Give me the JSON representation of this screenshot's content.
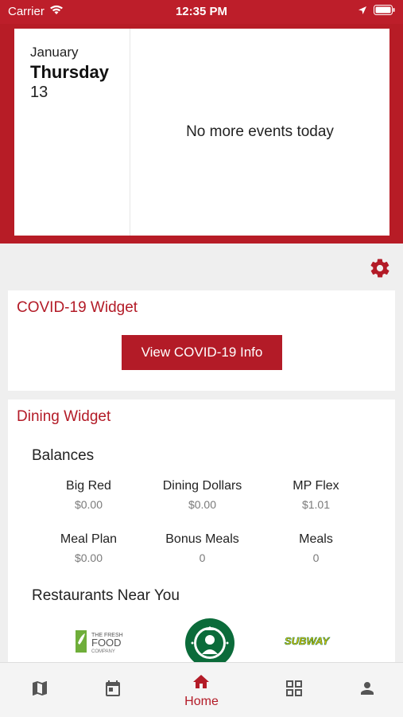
{
  "status_bar": {
    "carrier": "Carrier",
    "time": "12:35 PM"
  },
  "calendar": {
    "month": "January",
    "weekday": "Thursday",
    "day": "13",
    "empty_message": "No more events today"
  },
  "covid_widget": {
    "title": "COVID-19 Widget",
    "button_label": "View COVID-19 Info"
  },
  "dining_widget": {
    "title": "Dining Widget",
    "balances_heading": "Balances",
    "balances": [
      {
        "label": "Big Red",
        "value": "$0.00"
      },
      {
        "label": "Dining Dollars",
        "value": "$0.00"
      },
      {
        "label": "MP Flex",
        "value": "$1.01"
      },
      {
        "label": "Meal Plan",
        "value": "$0.00"
      },
      {
        "label": "Bonus Meals",
        "value": "0"
      },
      {
        "label": "Meals",
        "value": "0"
      }
    ],
    "restaurants_heading": "Restaurants Near You",
    "restaurants": [
      {
        "name": "THE FRESH FOOD COMPANY",
        "logo_lines": [
          "THE FRESH",
          "FOOD",
          "COMPANY"
        ]
      },
      {
        "name": "STARBUCKS COFFEE"
      },
      {
        "name": "SUBWAY",
        "logo_text": "SUBWAY"
      }
    ]
  },
  "tab_bar": {
    "tabs": [
      {
        "icon": "map-icon"
      },
      {
        "icon": "calendar-icon"
      },
      {
        "icon": "home-icon",
        "label": "Home",
        "active": true
      },
      {
        "icon": "grid-icon"
      },
      {
        "icon": "person-icon"
      }
    ]
  },
  "colors": {
    "brand_red": "#b31b27",
    "hero_red": "#b71c26",
    "page_background": "#efefef",
    "muted_text": "#7a7a7a"
  }
}
